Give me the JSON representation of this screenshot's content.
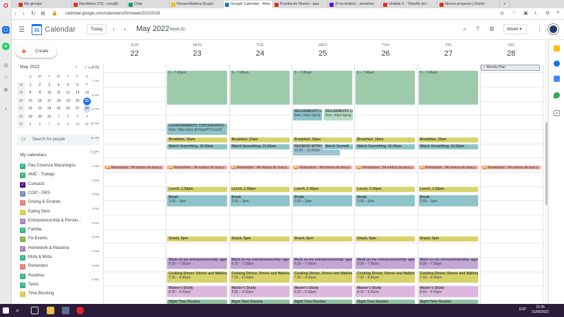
{
  "browser": {
    "tabs": [
      {
        "label": "My groups",
        "fav": "#d93025"
      },
      {
        "label": "Recibidos (72) - coo@c",
        "fav": "#d93025"
      },
      {
        "label": "Chat",
        "fav": "#0f9d58"
      },
      {
        "label": "Desarrolladora Grupo",
        "fav": "#fbbc04"
      },
      {
        "label": "Google Calendar - Wee",
        "fav": "#1a73e8"
      },
      {
        "label": "Prueba de Nuevo - pau",
        "fav": "#d93025"
      },
      {
        "label": "(6 no leídos) - anniemo",
        "fav": "#6001d2"
      },
      {
        "label": "Unidad 3 - \"Diseño de i",
        "fav": "#d93025"
      },
      {
        "label": "Nuevo proyecto | Domo",
        "fav": "#d93025"
      }
    ],
    "url": "calendar.google.com/calendar/u/0/r/week/2022/5/28"
  },
  "header": {
    "app_title": "Calendar",
    "logo_num": "31",
    "today_label": "Today",
    "month_title": "May 2022",
    "week_tag": "Week 21",
    "view_label": "Week"
  },
  "sidebar": {
    "create_label": "Create",
    "mini_month_title": "May 2022",
    "weekday_headers": [
      "S",
      "M",
      "T",
      "W",
      "T",
      "F",
      "S"
    ],
    "weeks": [
      {
        "wk": "18",
        "days": [
          "1",
          "2",
          "3",
          "4",
          "5",
          "6",
          "7"
        ]
      },
      {
        "wk": "19",
        "days": [
          "8",
          "9",
          "10",
          "11",
          "12",
          "13",
          "14"
        ]
      },
      {
        "wk": "20",
        "days": [
          "15",
          "16",
          "17",
          "18",
          "19",
          "20",
          "21"
        ]
      },
      {
        "wk": "21",
        "days": [
          "22",
          "23",
          "24",
          "25",
          "26",
          "27",
          "28"
        ]
      },
      {
        "wk": "22",
        "days": [
          "29",
          "30",
          "31",
          "1",
          "2",
          "3",
          "4"
        ]
      },
      {
        "wk": "23",
        "days": [
          "5",
          "6",
          "7",
          "8",
          "9",
          "10",
          "11"
        ]
      }
    ],
    "search_people": "Search for people",
    "my_calendars": "My calendars",
    "calendars": [
      {
        "name": "Pau Cosenza Mazariegos",
        "color": "#33b679"
      },
      {
        "name": "AMC - Trabajo",
        "color": "#33b679"
      },
      {
        "name": "Contacts",
        "color": "#4a148c"
      },
      {
        "name": "COO - GRS",
        "color": "#7986cb"
      },
      {
        "name": "Driving & Errands",
        "color": "#e67c73"
      },
      {
        "name": "Eating Slots",
        "color": "#d7c94a"
      },
      {
        "name": "Entrepreneurship & Person...",
        "color": "#ad7ec0"
      },
      {
        "name": "Familia",
        "color": "#33b679"
      },
      {
        "name": "Fix Events",
        "color": "#7cb342"
      },
      {
        "name": "Homework & Maestría",
        "color": "#ad7ec0"
      },
      {
        "name": "Mota & Mota",
        "color": "#33b679"
      },
      {
        "name": "Reminders",
        "color": "#e67c73"
      },
      {
        "name": "Routines",
        "color": "#33b679"
      },
      {
        "name": "Tasks",
        "color": "#33b679"
      },
      {
        "name": "Time Blocking",
        "color": "#d7c94a"
      }
    ]
  },
  "grid": {
    "gmt": "GMT-06",
    "days": [
      {
        "name": "SUN",
        "num": "22"
      },
      {
        "name": "MON",
        "num": "23"
      },
      {
        "name": "TUE",
        "num": "24"
      },
      {
        "name": "WED",
        "num": "25"
      },
      {
        "name": "THU",
        "num": "26"
      },
      {
        "name": "FRI",
        "num": "27"
      },
      {
        "name": "SAT",
        "num": "28"
      }
    ],
    "hours": [
      "9 AM",
      "7 AM",
      "8 AM",
      "9 AM",
      "10 AM",
      "11 AM",
      "12 PM",
      "1 PM",
      "2 PM",
      "3 PM",
      "4 PM",
      "5 PM",
      "6 PM",
      "7 PM",
      "8 PM",
      "9 PM"
    ],
    "allday": {
      "sat": "Weekly Plan"
    },
    "events": {
      "morning": "5 – 7:45am",
      "levantamiento_t": "LEVANTAMIENTO TOPOGRAFICO -",
      "levantamiento_s": "9am, https://goo.gl/maps/Ft7ocpX6",
      "seguimiento1_t": "SEGUIMIENTO LI",
      "seguimiento1_s": "8am, https://grup",
      "seguimiento2_t": "SEGUIMIENTO LI",
      "seguimiento2_s": "8am, https://grup",
      "breakfast": "Breakfast, 10am",
      "watch": "Watch Something, 10:30am",
      "reunion_t": "REUNIÓN INTRO",
      "reunion_s": "10:30 – 11:30am",
      "watch2": "Watch Someth",
      "reminder": "Remember : 94 metros de losa p",
      "lunch": "Lunch, 1:30pm",
      "break_t": "Break",
      "break_s": "2:05 – 3pm",
      "snack": "Snack, 5pm",
      "entre_t": "Work on my entrepreneurship: agen",
      "entre_s": "6:30 – 7:30pm",
      "dinner_t": "Cooking Dinner, Dinner and Walking",
      "dinner_s": "7:30 – 8:30pm",
      "masters_t": "Master's Study",
      "masters_s": "8:30 – 9:30pm",
      "night": "Night Time Routine"
    }
  },
  "taskbar": {
    "lang": "ESP",
    "time": "22:26",
    "date": "21/05/2022"
  },
  "colors": {
    "green": "#9ccaaa",
    "blue": "#8ec3c9",
    "yellow": "#d7d36a",
    "pink": "#f4a99f",
    "lilac": "#ddb7dd",
    "sage": "#8fbf9f",
    "purple": "#c3a6d6"
  }
}
